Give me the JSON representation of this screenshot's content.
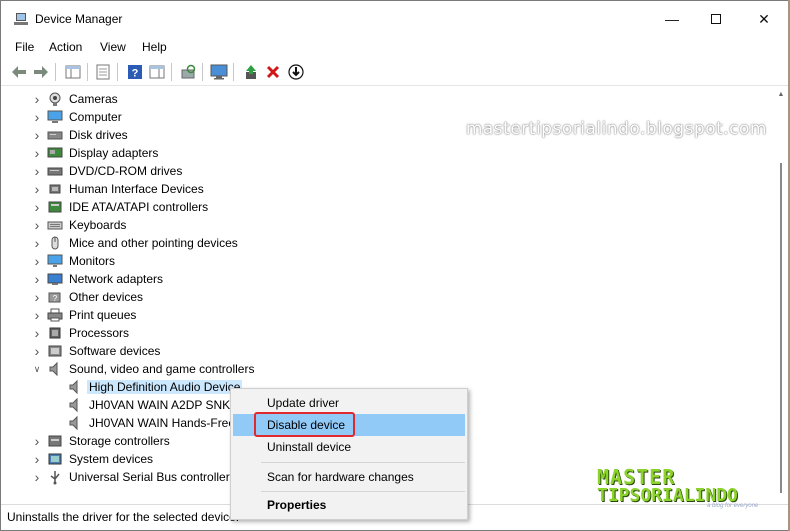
{
  "window": {
    "title": "Device Manager"
  },
  "menubar": {
    "items": [
      "File",
      "Action",
      "View",
      "Help"
    ]
  },
  "watermark": "mastertipsorialindo.blogspot.com",
  "tree": {
    "rows": [
      {
        "label": "Cameras",
        "icon": "camera-icon",
        "expanded": false
      },
      {
        "label": "Computer",
        "icon": "computer-icon",
        "expanded": false
      },
      {
        "label": "Disk drives",
        "icon": "disk-drive-icon",
        "expanded": false
      },
      {
        "label": "Display adapters",
        "icon": "display-adapter-icon",
        "expanded": false
      },
      {
        "label": "DVD/CD-ROM drives",
        "icon": "dvd-drive-icon",
        "expanded": false
      },
      {
        "label": "Human Interface Devices",
        "icon": "hid-icon",
        "expanded": false
      },
      {
        "label": "IDE ATA/ATAPI controllers",
        "icon": "ide-controller-icon",
        "expanded": false
      },
      {
        "label": "Keyboards",
        "icon": "keyboard-icon",
        "expanded": false
      },
      {
        "label": "Mice and other pointing devices",
        "icon": "mouse-icon",
        "expanded": false
      },
      {
        "label": "Monitors",
        "icon": "monitor-icon",
        "expanded": false
      },
      {
        "label": "Network adapters",
        "icon": "network-adapter-icon",
        "expanded": false
      },
      {
        "label": "Other devices",
        "icon": "unknown-device-icon",
        "expanded": false
      },
      {
        "label": "Print queues",
        "icon": "printer-icon",
        "expanded": false
      },
      {
        "label": "Processors",
        "icon": "processor-icon",
        "expanded": false
      },
      {
        "label": "Software devices",
        "icon": "software-device-icon",
        "expanded": false
      },
      {
        "label": "Sound, video and game controllers",
        "icon": "speaker-icon",
        "expanded": true
      },
      {
        "label": "High Definition Audio Device",
        "icon": "speaker-icon",
        "child": true,
        "selected": true
      },
      {
        "label": "JH0VAN WAIN A2DP SNK",
        "icon": "speaker-icon",
        "child": true
      },
      {
        "label": "JH0VAN WAIN Hands-Free",
        "icon": "speaker-icon",
        "child": true
      },
      {
        "label": "Storage controllers",
        "icon": "storage-controller-icon",
        "expanded": false
      },
      {
        "label": "System devices",
        "icon": "system-device-icon",
        "expanded": false
      },
      {
        "label": "Universal Serial Bus controllers",
        "icon": "usb-icon",
        "expanded": false
      }
    ]
  },
  "context_menu": {
    "update": "Update driver",
    "disable": "Disable device",
    "uninstall": "Uninstall device",
    "scan": "Scan for hardware changes",
    "properties": "Properties"
  },
  "statusbar": {
    "text": "Uninstalls the driver for the selected device."
  },
  "logo": {
    "line1": "MASTER",
    "line2": "TIPSORIALINDO",
    "small": "a blog for everyone"
  },
  "colors": {
    "highlight": "#91c9f7",
    "selection": "#cce8ff",
    "callout": "#e0282e",
    "logo": "#8bd22d"
  }
}
